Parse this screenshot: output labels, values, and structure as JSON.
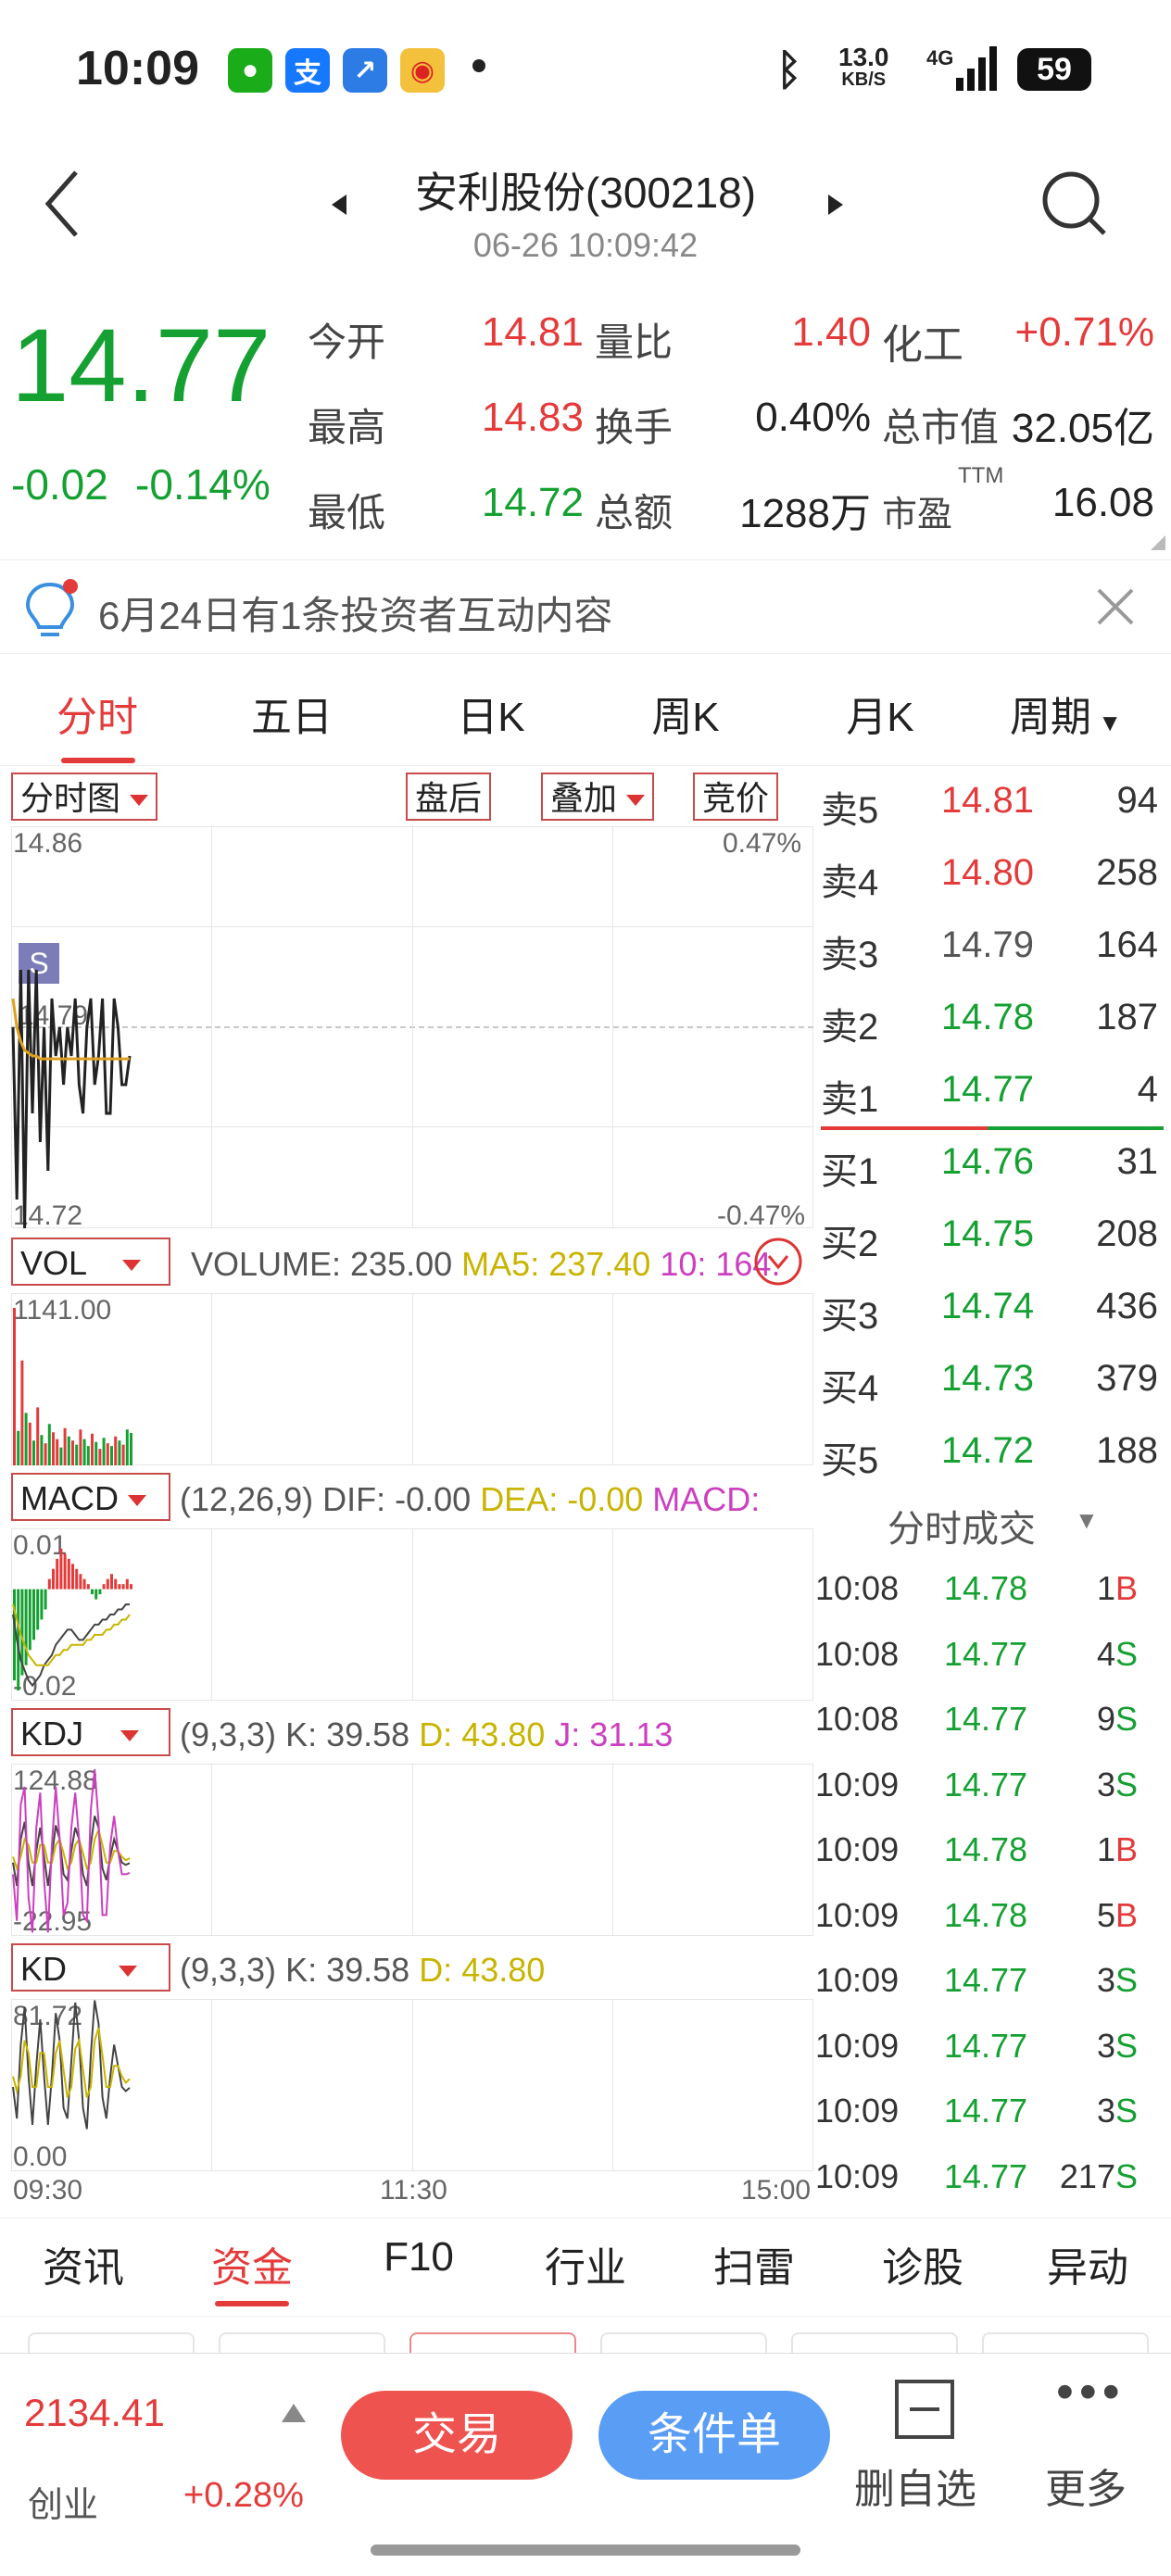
{
  "status_bar": {
    "time": "10:09",
    "net_speed_value": "13.0",
    "net_speed_unit": "KB/S",
    "net_type": "4G",
    "battery": "59"
  },
  "header": {
    "title": "安利股份(300218)",
    "datetime": "06-26 10:09:42"
  },
  "quote": {
    "price": "14.77",
    "change": "-0.02",
    "change_pct": "-0.14%",
    "rows": [
      [
        {
          "label": "今开",
          "value": "14.81"
        },
        {
          "label": "量比",
          "value": "1.40"
        },
        {
          "label": "化工",
          "value": "+0.71%"
        }
      ],
      [
        {
          "label": "最高",
          "value": "14.83"
        },
        {
          "label": "换手",
          "value": "0.40%"
        },
        {
          "label": "总市值",
          "value": "32.05亿"
        }
      ],
      [
        {
          "label": "最低",
          "value": "14.72"
        },
        {
          "label": "总额",
          "value": "1288万"
        },
        {
          "label": "市盈",
          "sup": "TTM",
          "value": "16.08"
        }
      ]
    ]
  },
  "notice": {
    "text": "6月24日有1条投资者互动内容"
  },
  "period_tabs": [
    "分时",
    "五日",
    "日K",
    "周K",
    "月K",
    "周期"
  ],
  "chart": {
    "toolbar": {
      "selector": "分时图",
      "after_hours": "盘后",
      "overlay": "叠加",
      "auction": "竞价"
    },
    "price_axis": {
      "top": "14.86",
      "mid": "14.79",
      "bottom": "14.72",
      "top_pct": "0.47%",
      "bottom_pct": "-0.47%"
    },
    "marker": "S",
    "time_axis": [
      "09:30",
      "11:30",
      "15:00"
    ],
    "price_series": [
      14.79,
      14.73,
      14.81,
      14.72,
      14.81,
      14.76,
      14.81,
      14.75,
      14.79,
      14.74,
      14.8,
      14.78,
      14.79,
      14.77,
      14.79,
      14.78,
      14.8,
      14.77,
      14.76,
      14.79,
      14.8,
      14.77,
      14.78,
      14.8,
      14.76,
      14.76,
      14.8,
      14.79,
      14.77,
      14.77,
      14.78
    ],
    "avg_series": [
      14.8,
      14.79,
      14.785,
      14.782,
      14.781,
      14.78,
      14.78,
      14.779,
      14.779,
      14.779,
      14.779,
      14.779,
      14.779,
      14.779,
      14.779,
      14.779,
      14.779,
      14.779,
      14.779,
      14.779,
      14.779,
      14.779,
      14.779,
      14.779,
      14.779,
      14.779,
      14.779,
      14.779,
      14.779,
      14.779,
      14.779
    ],
    "vol": {
      "selector": "VOL",
      "text": "VOLUME: 235.00",
      "ma5": "MA5: 237.40",
      "ma10": "10: 164.",
      "max": "1141.00",
      "bars": [
        1141,
        250,
        760,
        380,
        310,
        180,
        420,
        220,
        160,
        300,
        240,
        190,
        130,
        270,
        210,
        180,
        150,
        260,
        190,
        140,
        230,
        170,
        120,
        200,
        160,
        140,
        210,
        180,
        150,
        260,
        235
      ],
      "ups": [
        1,
        0,
        1,
        0,
        1,
        0,
        1,
        0,
        1,
        0,
        1,
        1,
        0,
        1,
        0,
        1,
        0,
        1,
        0,
        0,
        1,
        0,
        1,
        0,
        1,
        0,
        1,
        0,
        1,
        0,
        0
      ]
    },
    "macd": {
      "selector": "MACD",
      "params": "(12,26,9)",
      "dif": "DIF: -0.00",
      "dea": "DEA: -0.00",
      "macd": "MACD:",
      "top": "0.01",
      "bottom": "-0.02",
      "bars": [
        -0.018,
        -0.02,
        -0.017,
        -0.015,
        -0.012,
        -0.01,
        -0.008,
        -0.006,
        -0.004,
        0.002,
        0.004,
        0.006,
        0.008,
        0.007,
        0.006,
        0.005,
        0.004,
        0.003,
        0.002,
        0.001,
        -0.001,
        -0.002,
        -0.001,
        0.001,
        0.002,
        0.003,
        0.002,
        0.001,
        0.001,
        0.002,
        0.001
      ],
      "dif_line": [
        -0.005,
        -0.01,
        -0.014,
        -0.016,
        -0.018,
        -0.019,
        -0.018,
        -0.017,
        -0.015,
        -0.014,
        -0.013,
        -0.011,
        -0.01,
        -0.009,
        -0.008,
        -0.008,
        -0.009,
        -0.01,
        -0.01,
        -0.009,
        -0.008,
        -0.007,
        -0.007,
        -0.006,
        -0.006,
        -0.005,
        -0.005,
        -0.004,
        -0.004,
        -0.003,
        -0.003
      ],
      "dea_line": [
        -0.003,
        -0.006,
        -0.009,
        -0.011,
        -0.013,
        -0.014,
        -0.015,
        -0.015,
        -0.015,
        -0.015,
        -0.014,
        -0.013,
        -0.013,
        -0.012,
        -0.012,
        -0.011,
        -0.011,
        -0.011,
        -0.011,
        -0.01,
        -0.01,
        -0.009,
        -0.009,
        -0.009,
        -0.008,
        -0.008,
        -0.007,
        -0.007,
        -0.006,
        -0.006,
        -0.005
      ]
    },
    "kdj": {
      "selector": "KDJ",
      "params": "(9,3,3)",
      "k": "K: 39.58",
      "d": "D: 43.80",
      "j": "J: 31.13",
      "top": "124.88",
      "bottom": "-22.95",
      "k_line": [
        40,
        20,
        60,
        75,
        40,
        20,
        50,
        70,
        45,
        20,
        45,
        72,
        60,
        30,
        25,
        50,
        70,
        60,
        30,
        20,
        55,
        80,
        70,
        35,
        25,
        45,
        60,
        50,
        40,
        38,
        39.58
      ],
      "d_line": [
        45,
        35,
        45,
        60,
        55,
        40,
        40,
        55,
        55,
        40,
        40,
        55,
        60,
        48,
        35,
        40,
        55,
        60,
        48,
        35,
        40,
        60,
        68,
        55,
        40,
        40,
        50,
        50,
        45,
        42,
        43.8
      ],
      "j_line": [
        30,
        -10,
        90,
        105,
        10,
        -20,
        70,
        100,
        25,
        -20,
        55,
        105,
        60,
        -5,
        5,
        70,
        100,
        60,
        -5,
        -10,
        85,
        120,
        75,
        -5,
        -5,
        55,
        80,
        50,
        30,
        30,
        31.13
      ]
    },
    "kd": {
      "selector": "KD",
      "params": "(9,3,3)",
      "k": "K: 39.58",
      "d": "D: 43.80",
      "top": "81.72",
      "bottom": "0.00",
      "k_line": [
        40,
        25,
        60,
        78,
        45,
        22,
        50,
        72,
        45,
        22,
        45,
        75,
        62,
        30,
        25,
        52,
        80,
        62,
        30,
        20,
        55,
        81,
        70,
        35,
        25,
        45,
        60,
        50,
        40,
        38,
        39.58
      ],
      "d_line": [
        45,
        38,
        45,
        62,
        56,
        40,
        40,
        56,
        56,
        40,
        40,
        56,
        62,
        48,
        35,
        40,
        58,
        62,
        48,
        35,
        40,
        62,
        68,
        55,
        40,
        40,
        50,
        50,
        45,
        42,
        43.8
      ]
    }
  },
  "order_book": {
    "asks": [
      {
        "label": "卖5",
        "price": "14.81",
        "vol": "94",
        "color": "red"
      },
      {
        "label": "卖4",
        "price": "14.80",
        "vol": "258",
        "color": "red"
      },
      {
        "label": "卖3",
        "price": "14.79",
        "vol": "164",
        "color": "gray"
      },
      {
        "label": "卖2",
        "price": "14.78",
        "vol": "187",
        "color": "green"
      },
      {
        "label": "卖1",
        "price": "14.77",
        "vol": "4",
        "color": "green"
      }
    ],
    "bids": [
      {
        "label": "买1",
        "price": "14.76",
        "vol": "31",
        "color": "green"
      },
      {
        "label": "买2",
        "price": "14.75",
        "vol": "208",
        "color": "green"
      },
      {
        "label": "买3",
        "price": "14.74",
        "vol": "436",
        "color": "green"
      },
      {
        "label": "买4",
        "price": "14.73",
        "vol": "379",
        "color": "green"
      },
      {
        "label": "买5",
        "price": "14.72",
        "vol": "188",
        "color": "green"
      }
    ]
  },
  "ticks": {
    "title": "分时成交",
    "rows": [
      {
        "time": "10:08",
        "price": "14.78",
        "vol": "1",
        "side": "B"
      },
      {
        "time": "10:08",
        "price": "14.77",
        "vol": "4",
        "side": "S"
      },
      {
        "time": "10:08",
        "price": "14.77",
        "vol": "9",
        "side": "S"
      },
      {
        "time": "10:09",
        "price": "14.77",
        "vol": "3",
        "side": "S"
      },
      {
        "time": "10:09",
        "price": "14.78",
        "vol": "1",
        "side": "B"
      },
      {
        "time": "10:09",
        "price": "14.78",
        "vol": "5",
        "side": "B"
      },
      {
        "time": "10:09",
        "price": "14.77",
        "vol": "3",
        "side": "S"
      },
      {
        "time": "10:09",
        "price": "14.77",
        "vol": "3",
        "side": "S"
      },
      {
        "time": "10:09",
        "price": "14.77",
        "vol": "3",
        "side": "S"
      },
      {
        "time": "10:09",
        "price": "14.77",
        "vol": "217",
        "side": "S"
      }
    ]
  },
  "bottom_tabs": [
    "资讯",
    "资金",
    "F10",
    "行业",
    "扫雷",
    "诊股",
    "异动"
  ],
  "footer": {
    "index_value": "2134.41",
    "index_name": "创业",
    "index_change": "+0.28%",
    "trade": "交易",
    "conditional": "条件单",
    "remove_watch": "删自选",
    "more": "更多"
  },
  "colors": {
    "up": "#e43a3a",
    "down": "#15a032",
    "accent": "#e43a3a",
    "orange": "#e8841b",
    "yellow": "#c8b400",
    "magenta": "#cc3fbf",
    "blue_btn": "#5a9df5"
  }
}
